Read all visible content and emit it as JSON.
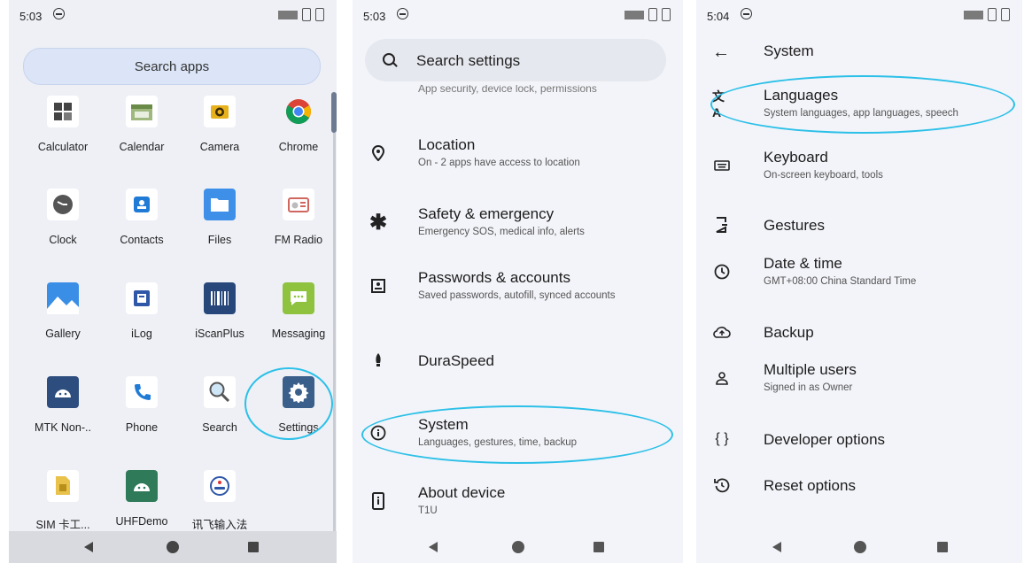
{
  "panel1": {
    "status": {
      "time": "5:03"
    },
    "search_placeholder": "Search apps",
    "apps": [
      {
        "label": "Calculator",
        "icon": "calculator-icon"
      },
      {
        "label": "Calendar",
        "icon": "calendar-icon"
      },
      {
        "label": "Camera",
        "icon": "camera-icon"
      },
      {
        "label": "Chrome",
        "icon": "chrome-icon"
      },
      {
        "label": "Clock",
        "icon": "clock-icon"
      },
      {
        "label": "Contacts",
        "icon": "contacts-icon"
      },
      {
        "label": "Files",
        "icon": "files-icon"
      },
      {
        "label": "FM Radio",
        "icon": "fm-radio-icon"
      },
      {
        "label": "Gallery",
        "icon": "gallery-icon"
      },
      {
        "label": "iLog",
        "icon": "ilog-icon"
      },
      {
        "label": "iScanPlus",
        "icon": "iscanplus-icon"
      },
      {
        "label": "Messaging",
        "icon": "messaging-icon"
      },
      {
        "label": "MTK Non-..",
        "icon": "android-icon"
      },
      {
        "label": "Phone",
        "icon": "phone-icon"
      },
      {
        "label": "Search",
        "icon": "search-icon"
      },
      {
        "label": "Settings",
        "icon": "settings-gear-icon"
      },
      {
        "label": "SIM 卡工...",
        "icon": "sim-toolkit-icon"
      },
      {
        "label": "UHFDemo",
        "icon": "android-icon"
      },
      {
        "label": "讯飞输入法",
        "icon": "ime-icon"
      }
    ]
  },
  "panel2": {
    "status": {
      "time": "5:03"
    },
    "search_text": "Search settings",
    "cut_text": "App security, device lock, permissions",
    "items": [
      {
        "title": "Location",
        "subtitle": "On - 2 apps have access to location",
        "icon": "location-pin-icon"
      },
      {
        "title": "Safety & emergency",
        "subtitle": "Emergency SOS, medical info, alerts",
        "icon": "asterisk-icon"
      },
      {
        "title": "Passwords & accounts",
        "subtitle": "Saved passwords, autofill, synced accounts",
        "icon": "account-box-icon"
      },
      {
        "title": "DuraSpeed",
        "subtitle": "",
        "icon": "rocket-icon"
      },
      {
        "title": "System",
        "subtitle": "Languages, gestures, time, backup",
        "icon": "info-icon"
      },
      {
        "title": "About device",
        "subtitle": "T1U",
        "icon": "device-info-icon"
      }
    ]
  },
  "panel3": {
    "status": {
      "time": "5:04"
    },
    "title": "System",
    "items": [
      {
        "title": "Languages",
        "subtitle": "System languages, app languages, speech",
        "icon": "translate-icon"
      },
      {
        "title": "Keyboard",
        "subtitle": "On-screen keyboard, tools",
        "icon": "keyboard-icon"
      },
      {
        "title": "Gestures",
        "subtitle": "",
        "icon": "gestures-icon"
      },
      {
        "title": "Date & time",
        "subtitle": "GMT+08:00 China Standard Time",
        "icon": "clock-icon"
      },
      {
        "title": "Backup",
        "subtitle": "",
        "icon": "cloud-backup-icon"
      },
      {
        "title": "Multiple users",
        "subtitle": "Signed in as Owner",
        "icon": "person-icon"
      },
      {
        "title": "Developer options",
        "subtitle": "",
        "icon": "braces-icon"
      },
      {
        "title": "Reset options",
        "subtitle": "",
        "icon": "reset-icon"
      }
    ]
  },
  "colors": {
    "highlight": "#2cc0e8",
    "settings_icon": "#3a5f8a"
  }
}
